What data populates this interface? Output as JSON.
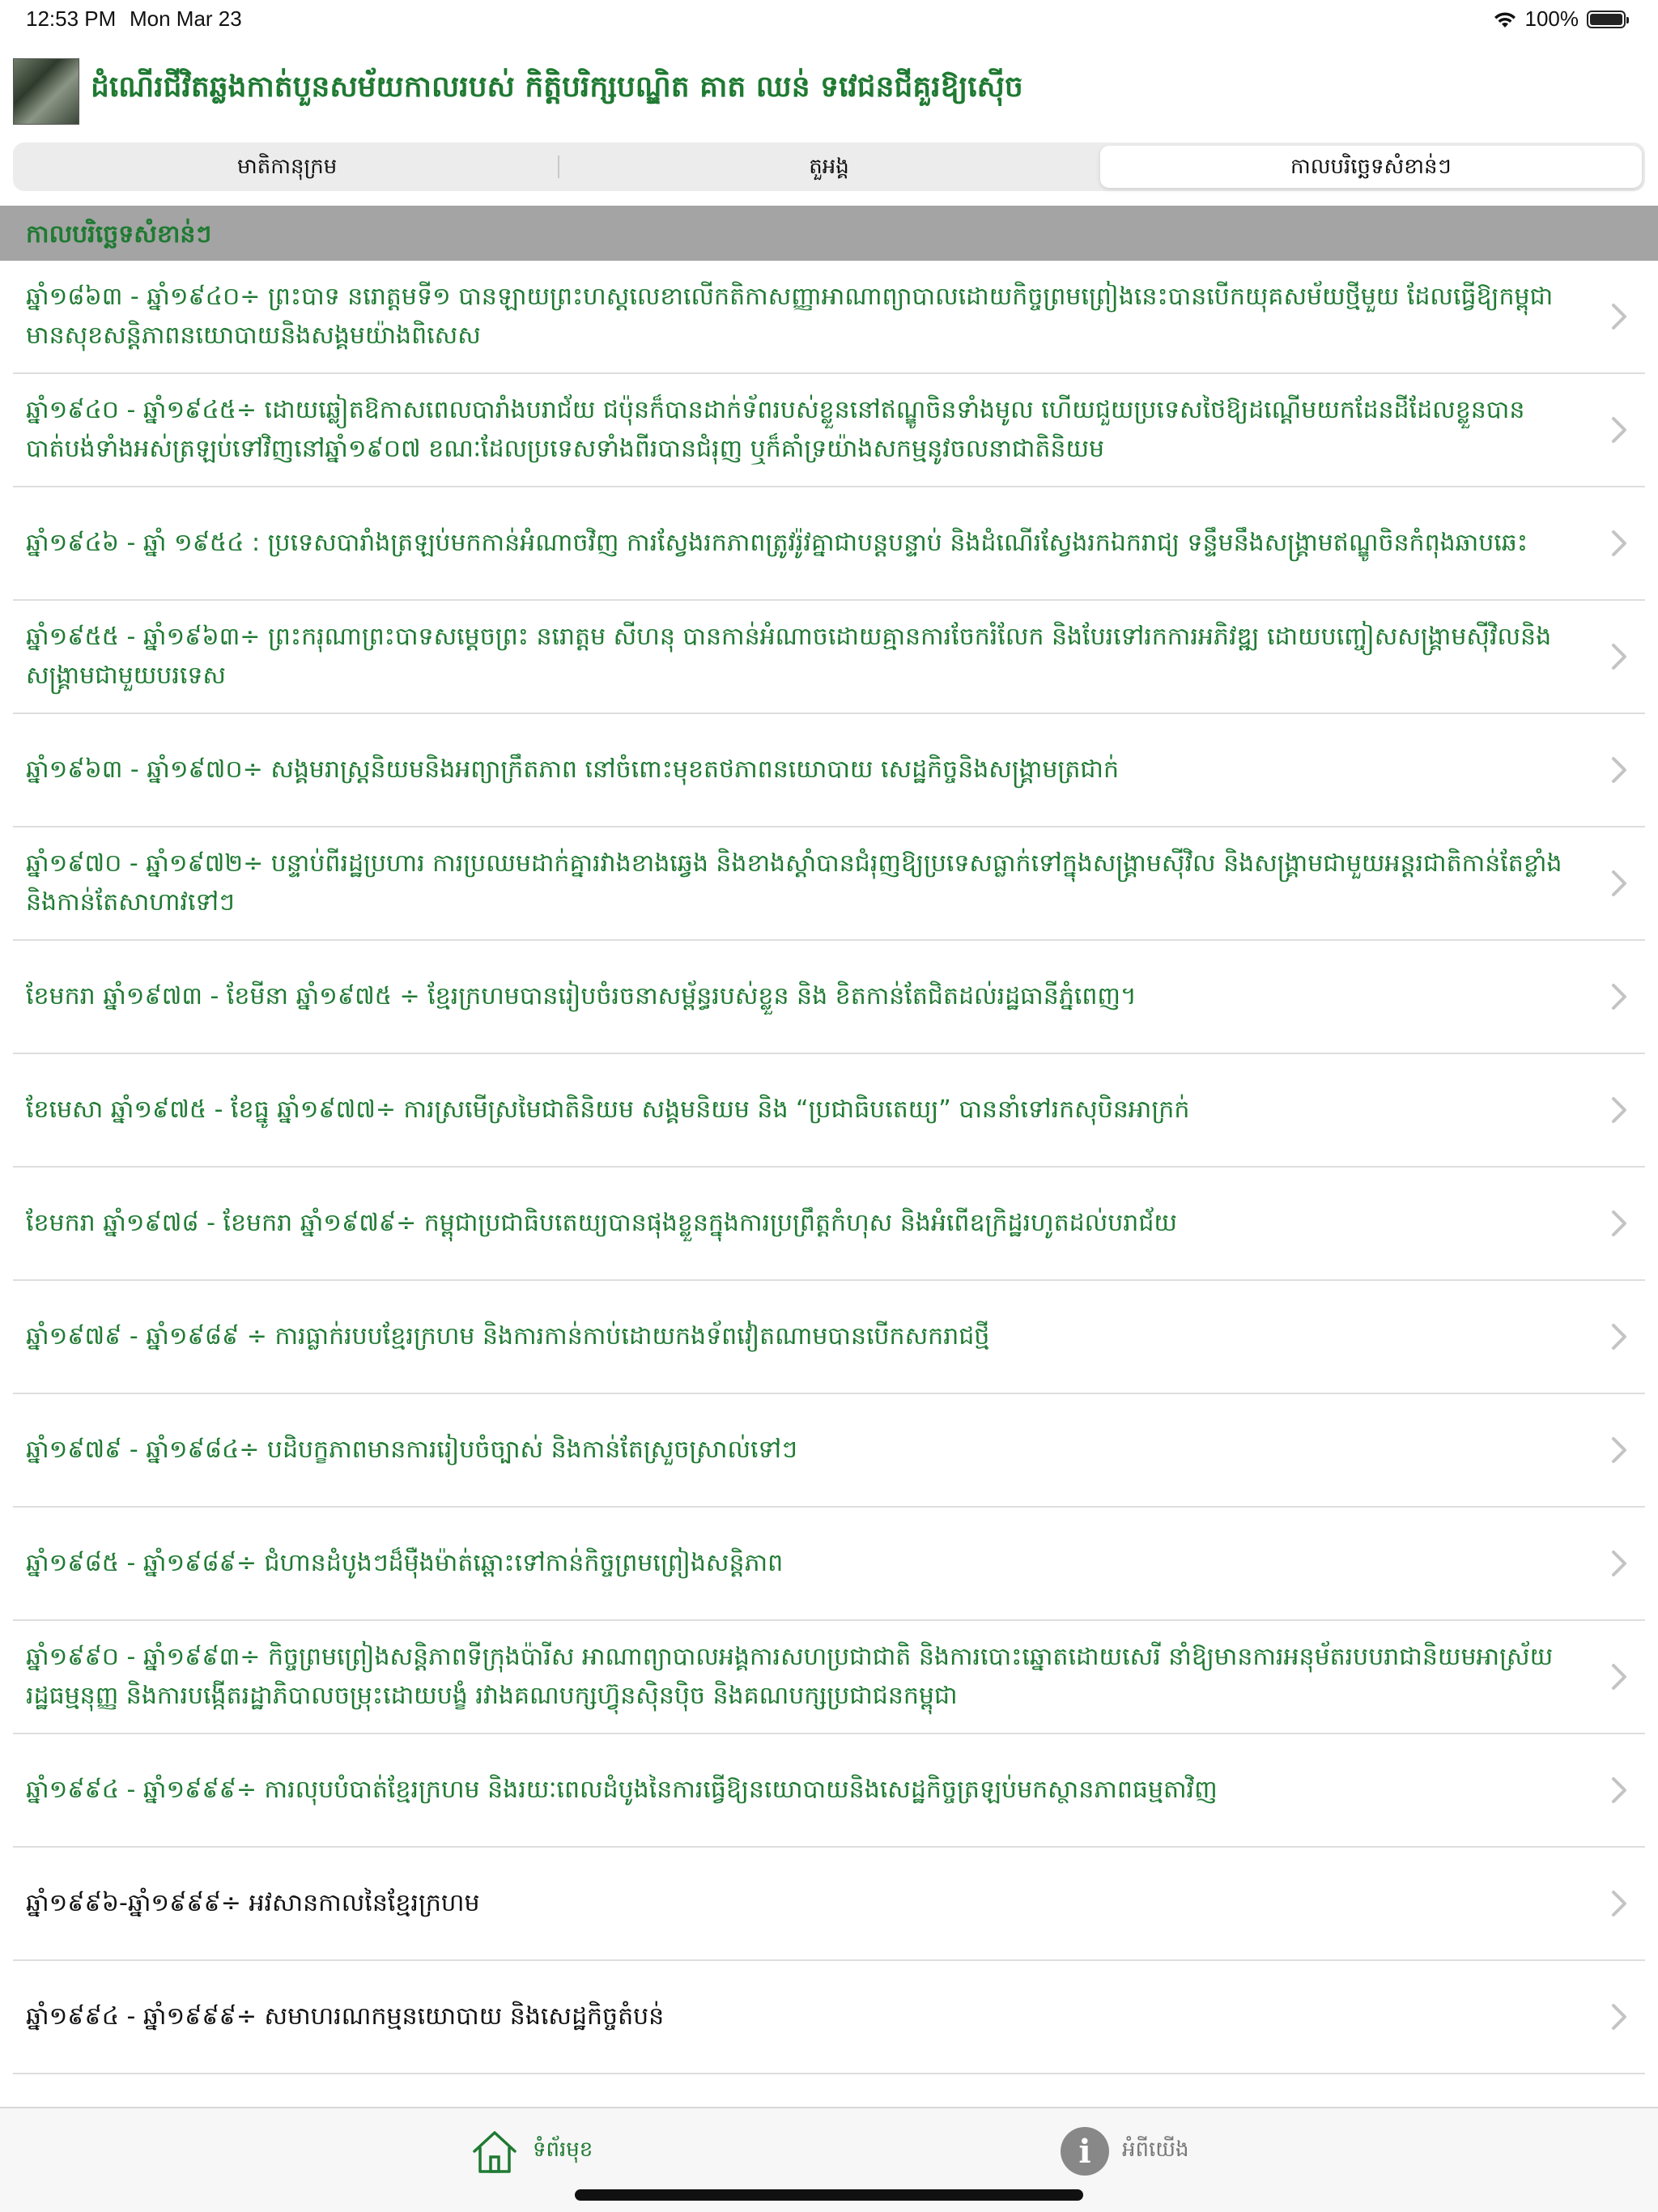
{
  "status_bar": {
    "time": "12:53 PM",
    "date": "Mon Mar 23",
    "battery": "100%"
  },
  "header": {
    "title": "ដំណើរជីវិតឆ្លងកាត់បួនសម័យកាលរបស់ កិត្តិបរិក្សបណ្ឌិត គាត ឈន់ ទវេជនជីគួរឱ្យស៊ើច"
  },
  "tabs": [
    {
      "label": "មាតិកានុក្រម",
      "active": false
    },
    {
      "label": "តួអង្គ",
      "active": false
    },
    {
      "label": "កាលបរិច្ឆេទសំខាន់ៗ",
      "active": true
    }
  ],
  "section": {
    "title": "កាលបរិច្ឆេទសំខាន់ៗ"
  },
  "items": [
    {
      "text": "ឆ្នាំ១៨៦៣ - ឆ្នាំ១៩៤០÷ ព្រះបាទ នរោត្តមទី១ បានឡាយព្រះហស្តលេខាលើកតិកាសញ្ញាអាណាព្យាបាលដោយកិច្ចព្រមព្រៀងនេះបានបើកយុគសម័យថ្មីមួយ ដែលធ្វើឱ្យកម្ពុជាមានសុខសន្តិភាពនយោបាយនិងសង្គមយ៉ាងពិសេស",
      "color": "green"
    },
    {
      "text": "ឆ្នាំ១៩៤០ - ឆ្នាំ១៩៤៥÷ ដោយឆ្លៀតឱកាសពេលបារាំងបរាជ័យ ជប៉ុនក៏បានដាក់ទ័ពរបស់ខ្លួននៅឥណ្ឌូចិនទាំងមូល ហើយជួយប្រទេសថៃឱ្យដណ្តើមយកដែនដីដែលខ្លួនបានបាត់បង់ទាំងអស់ត្រឡប់ទៅវិញនៅឆ្នាំ១៩០៧ ខណៈដែលប្រទេសទាំងពីរបានជំរុញ ឬក៏គាំទ្រយ៉ាងសកម្មនូវចលនាជាតិនិយម",
      "color": "green"
    },
    {
      "text": "ឆ្នាំ១៩៤៦ - ឆ្នាំ ១៩៥៤ : ប្រទេសបារាំងត្រឡប់មកកាន់អំណាចវិញ ការស្វែងរកភាពត្រូវរ៉ូវគ្នាជាបន្តបន្ទាប់ និងដំណើរស្វែងរកឯករាជ្យ ទន្ទឹមនឹងសង្គ្រាមឥណ្ឌូចិនកំពុងឆាបឆេះ",
      "color": "green"
    },
    {
      "text": "ឆ្នាំ១៩៥៥ - ឆ្នាំ១៩៦៣÷ ព្រះករុណាព្រះបាទសម្តេចព្រះ នរោត្តម សីហនុ បានកាន់អំណាចដោយគ្មានការចែករំលែក និងបែរទៅរកការអភិវឌ្ឍ ដោយបញ្ចៀសសង្គ្រាមស៊ីវិលនិងសង្គ្រាមជាមួយបរទេស",
      "color": "green"
    },
    {
      "text": "ឆ្នាំ១៩៦៣ - ឆ្នាំ១៩៧០÷ សង្គមរាស្ត្រនិយមនិងអព្យាក្រឹតភាព នៅចំពោះមុខតថភាពនយោបាយ សេដ្ឋកិច្ចនិងសង្គ្រាមត្រជាក់",
      "color": "green"
    },
    {
      "text": "ឆ្នាំ១៩៧០ - ឆ្នាំ១៩៧២÷ បន្ទាប់ពីរដ្ឋប្រហារ ការប្រឈមដាក់គ្នារវាងខាងឆ្វេង និងខាងស្តាំបានជំរុញឱ្យប្រទេសធ្លាក់ទៅក្នុងសង្គ្រាមស៊ីវិល និងសង្គ្រាមជាមួយអន្តរជាតិកាន់តែខ្លាំងនិងកាន់តែសាហាវទៅៗ",
      "color": "green"
    },
    {
      "text": "ខែមករា ឆ្នាំ១៩៧៣ - ខែមីនា ឆ្នាំ១៩៧៥ ÷ ខ្មែរក្រហមបានរៀបចំរចនាសម្ព័ន្ធរបស់ខ្លួន និង ខិតកាន់តែជិតដល់រដ្ឋធានីភ្នំពេញ។",
      "color": "green"
    },
    {
      "text": "ខែមេសា ឆ្នាំ១៩៧៥ - ខែធ្នូ ឆ្នាំ១៩៧៧÷ ការស្រមើស្រមៃជាតិនិយម សង្គមនិយម និង “ប្រជាធិបតេយ្យ” បាននាំទៅរកសុបិនអាក្រក់",
      "color": "green"
    },
    {
      "text": "ខែមករា ឆ្នាំ១៩៧៨ - ខែមករា ឆ្នាំ១៩៧៩÷ កម្ពុជាប្រជាធិបតេយ្យបានផុងខ្លួនក្នុងការប្រព្រឹត្តកំហុស និងអំពើឧក្រិដ្ឋរហូតដល់បរាជ័យ",
      "color": "green"
    },
    {
      "text": "ឆ្នាំ១៩៧៩ - ឆ្នាំ១៩៨៩ ÷ ការធ្លាក់របបខ្មែរក្រហម និងការកាន់កាប់ដោយកងទ័ពវៀតណាមបានបើកសករាជថ្មី",
      "color": "green"
    },
    {
      "text": "ឆ្នាំ១៩៧៩ - ឆ្នាំ១៩៨៤÷ បដិបក្ខភាពមានការរៀបចំច្បាស់ និងកាន់តែស្រួចស្រាល់ទៅៗ",
      "color": "green"
    },
    {
      "text": "ឆ្នាំ១៩៨៥ - ឆ្នាំ១៩៨៩÷ ជំហានដំបូងៗដ៏មុឺងម៉ាត់ឆ្ពោះទៅកាន់កិច្ចព្រមព្រៀងសន្តិភាព",
      "color": "green"
    },
    {
      "text": "ឆ្នាំ១៩៩០ - ឆ្នាំ១៩៩៣÷ កិច្ចព្រមព្រៀងសន្តិភាពទីក្រុងប៉ារីស អាណាព្យាបាលអង្គការសហប្រជាជាតិ និងការបោះឆ្នោតដោយសេរី នាំឱ្យមានការអនុម័តរបបរាជានិយមអាស្រ័យរដ្ឋធម្មនុញ្ញ និងការបង្កើតរដ្ឋាភិបាលចម្រុះដោយបង្ខំ រវាងគណបក្សហ៊្វុនស៊ិនប៉ិច និងគណបក្សប្រជាជនកម្ពុជា",
      "color": "green"
    },
    {
      "text": "ឆ្នាំ១៩៩៤ - ឆ្នាំ១៩៩៩÷ ការលុបបំបាត់ខ្មែរក្រហម និងរយៈពេលដំបូងនៃការធ្វើឱ្យនយោបាយនិងសេដ្ឋកិច្ចត្រឡប់មកស្ថានភាពធម្មតាវិញ",
      "color": "green"
    },
    {
      "text": "ឆ្នាំ១៩៩៦-ឆ្នាំ១៩៩៩÷ អវសានកាលនៃខ្មែរក្រហម",
      "color": "black"
    },
    {
      "text": "ឆ្នាំ១៩៩៤ - ឆ្នាំ១៩៩៩÷ សមាហរណកម្មនយោបាយ និងសេដ្ឋកិច្ចតំបន់",
      "color": "black"
    }
  ],
  "tab_bar": {
    "home_label": "ទំព័រមុខ",
    "about_label": "អំពីយើង"
  },
  "colors": {
    "accent_green": "#1f7a32",
    "section_bg": "#a4a4a4",
    "separator": "#dedede"
  }
}
